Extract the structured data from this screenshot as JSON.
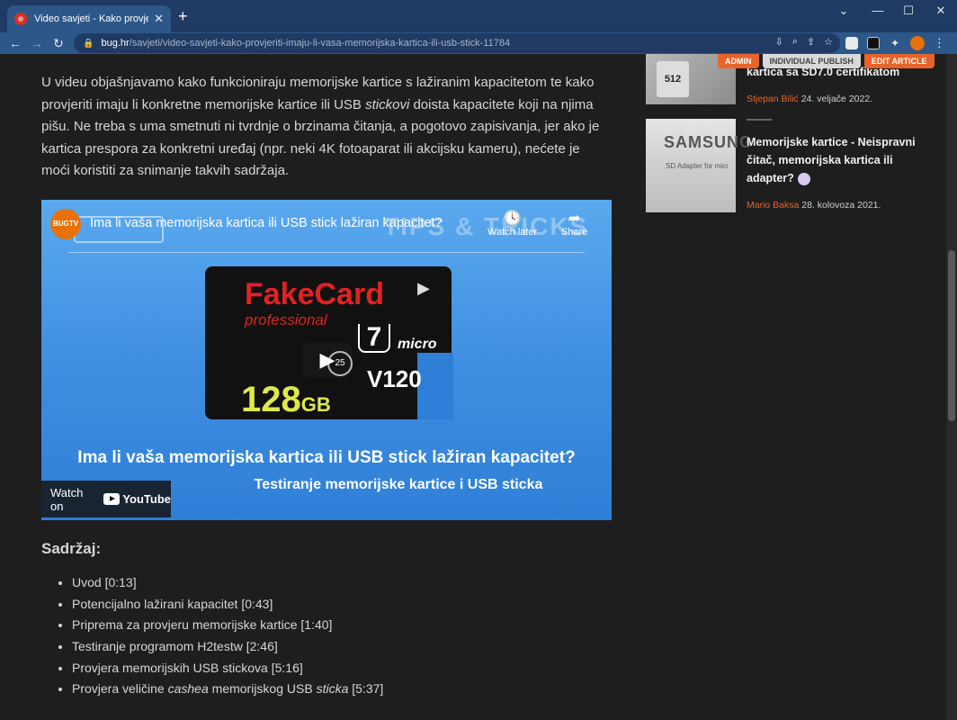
{
  "browser": {
    "tab_title": "Video savjeti - Kako provjeriti imaju li vaša memorijska kartica ili USB stick",
    "url_host": "bug.hr",
    "url_path": "/savjeti/video-savjeti-kako-provjeriti-imaju-li-vasa-memorijska-kartica-ili-usb-stick-11784"
  },
  "admin_bar": {
    "admin": "ADMIN",
    "publish": "INDIVIDUAL PUBLISH",
    "edit": "EDIT ARTICLE"
  },
  "article": {
    "intro_before": "U videu objašnjavamo kako funkcioniraju memorijske kartice s lažiranim kapacitetom te kako provjeriti imaju li konkretne memorijske kartice ili USB ",
    "intro_em": "stickovi",
    "intro_after": " doista kapacitete koji na njima pišu. Ne treba s uma smetnuti ni tvrdnje o brzinama čitanja, a pogotovo zapisivanja, jer ako je kartica prespora za konkretni uređaj (npr. neki 4K fotoaparat ili akcijsku kameru), nećete je moći koristiti za snimanje takvih sadržaja."
  },
  "video": {
    "channel": "BUGTV",
    "title": "Ima li vaša memorijska kartica ili USB stick lažiran kapacitet?",
    "bg_text": "TIPS & TRICKS",
    "watch_later": "Watch later",
    "share": "Share",
    "card_brand": "FakeCard",
    "card_sub": "professional",
    "card_u": "7",
    "card_micro": "micro",
    "card_v": "V120",
    "card_cap": "128",
    "card_unit": "GB",
    "replay": "25",
    "headline": "Ima li vaša memorijska kartica ili USB stick lažiran kapacitet?",
    "subline": "Testiranje memorijske kartice i USB sticka",
    "watch_on": "Watch on",
    "youtube": "YouTube"
  },
  "toc": {
    "title": "Sadržaj:",
    "items": [
      {
        "text": "Uvod [0:13]"
      },
      {
        "text": "Potencijalno lažirani kapacitet [0:43]"
      },
      {
        "text": "Priprema za provjeru memorijske kartice [1:40]"
      },
      {
        "text": "Testiranje programom H2testw [2:46]"
      },
      {
        "text": "Provjera memorijskih USB stickova [5:16]"
      },
      {
        "pre": "Provjera veličine ",
        "em1": "cashea",
        "mid": " memorijskog USB ",
        "em2": "sticka",
        "post": " [5:37]"
      }
    ]
  },
  "sidebar": {
    "items": [
      {
        "thumb": "512",
        "title": "kartica sa SD7.0 certifikatom",
        "author": "Stjepan Bilić",
        "date": "24. veljače 2022."
      },
      {
        "thumb": "SAMSUNG",
        "thumb_sub": "SD Adapter for micr",
        "title": "Memorijske kartice - Neispravni čitač, memorijska kartica ili adapter?",
        "author": "Mario Baksa",
        "date": "28. kolovoza 2021."
      }
    ]
  }
}
